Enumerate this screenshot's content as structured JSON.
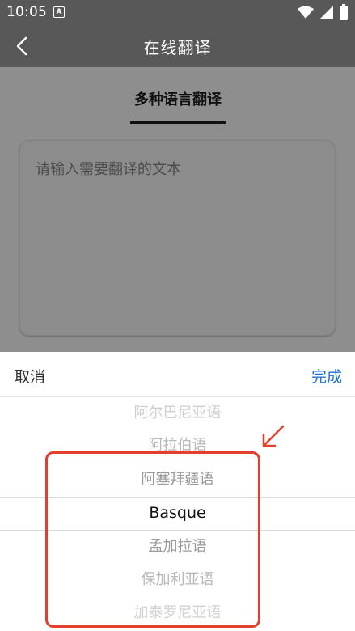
{
  "status_bar": {
    "time": "10:05",
    "notification_glyph": "A"
  },
  "nav": {
    "title": "在线翻译"
  },
  "tabs": [
    {
      "label": "多种语言翻译",
      "active": true
    }
  ],
  "input": {
    "placeholder": "请输入需要翻译的文本",
    "value": ""
  },
  "sheet": {
    "cancel_label": "取消",
    "done_label": "完成",
    "options": [
      "阿尔巴尼亚语",
      "阿拉伯语",
      "阿塞拜疆语",
      "Basque",
      "孟加拉语",
      "保加利亚语",
      "加泰罗尼亚语"
    ],
    "selected_index": 3
  },
  "colors": {
    "header_bg": "#585858",
    "overlay_bg": "#8e8e8e",
    "done_blue": "#1e73d6",
    "highlight_red": "#e2402c"
  },
  "icons": {
    "back": "back-chevron-icon",
    "wifi": "wifi-icon",
    "signal": "signal-icon",
    "battery": "battery-icon",
    "notification": "notification-a-icon"
  }
}
